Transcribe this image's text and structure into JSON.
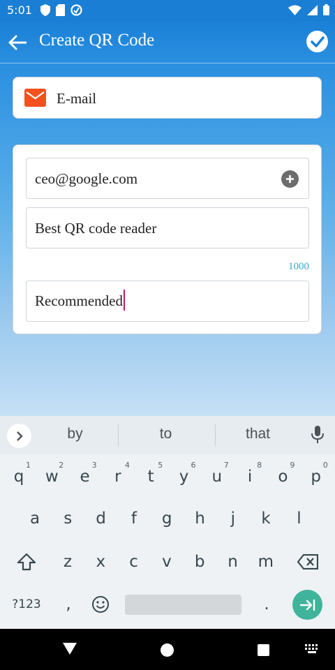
{
  "status_bar": {
    "time": "5:01"
  },
  "app_bar": {
    "title": "Create QR Code"
  },
  "type_selector": {
    "label": "E-mail",
    "icon": "email-icon"
  },
  "form": {
    "email_value": "ceo@google.com",
    "subject_value": "Best QR code reader",
    "char_counter": "1000",
    "body_value": "Recommended"
  },
  "keyboard": {
    "suggestions": [
      "by",
      "to",
      "that"
    ],
    "row1": [
      {
        "k": "q",
        "n": "1"
      },
      {
        "k": "w",
        "n": "2"
      },
      {
        "k": "e",
        "n": "3"
      },
      {
        "k": "r",
        "n": "4"
      },
      {
        "k": "t",
        "n": "5"
      },
      {
        "k": "y",
        "n": "6"
      },
      {
        "k": "u",
        "n": "7"
      },
      {
        "k": "i",
        "n": "8"
      },
      {
        "k": "o",
        "n": "9"
      },
      {
        "k": "p",
        "n": "0"
      }
    ],
    "row2": [
      "a",
      "s",
      "d",
      "f",
      "g",
      "h",
      "j",
      "k",
      "l"
    ],
    "row3": [
      "z",
      "x",
      "c",
      "v",
      "b",
      "n",
      "m"
    ],
    "symbols_label": "?123",
    "comma": ",",
    "period": "."
  },
  "colors": {
    "app_bar": "#1a80d6",
    "accent_email": "#f4511e",
    "counter": "#3aa7c7",
    "enter_key": "#3fb49a"
  }
}
